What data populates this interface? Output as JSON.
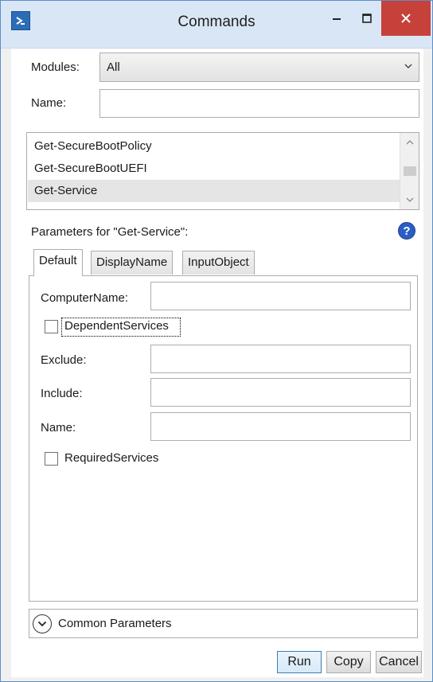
{
  "window": {
    "title": "Commands",
    "minimize_glyph": "–",
    "maximize_glyph": "□",
    "close_glyph": "✕"
  },
  "modules": {
    "label": "Modules:",
    "value": "All",
    "arrow": "⌄"
  },
  "name_filter": {
    "label": "Name:",
    "value": ""
  },
  "command_list": {
    "items": [
      {
        "label": "Get-SecureBootPolicy",
        "selected": false
      },
      {
        "label": "Get-SecureBootUEFI",
        "selected": false
      },
      {
        "label": "Get-Service",
        "selected": true
      }
    ]
  },
  "parameters": {
    "heading": "Parameters for \"Get-Service\":",
    "help_glyph": "?",
    "tabs": [
      "Default",
      "DisplayName",
      "InputObject"
    ],
    "active_tab": "Default",
    "fields": {
      "computer_name": {
        "label": "ComputerName:",
        "value": ""
      },
      "dependent_services": {
        "label": "DependentServices",
        "checked": false
      },
      "exclude": {
        "label": "Exclude:",
        "value": ""
      },
      "include": {
        "label": "Include:",
        "value": ""
      },
      "name": {
        "label": "Name:",
        "value": ""
      },
      "required_services": {
        "label": "RequiredServices",
        "checked": false
      }
    }
  },
  "common_parameters": {
    "label": "Common Parameters"
  },
  "buttons": {
    "run": "Run",
    "copy": "Copy",
    "cancel": "Cancel"
  },
  "icons": {
    "app": "powershell-icon",
    "help": "help-icon",
    "expand": "chevron-down-circle-icon"
  },
  "colors": {
    "titlebar": "#d9e6f5",
    "close_button": "#c7413b",
    "help_icon": "#2a5ec4",
    "default_button_border": "#3c7fb1"
  }
}
